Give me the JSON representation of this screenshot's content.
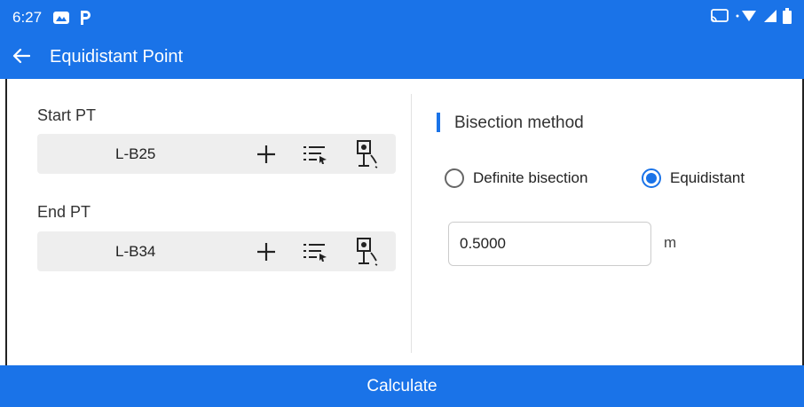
{
  "status_bar": {
    "time": "6:27",
    "icons": [
      "photos-icon",
      "p-icon"
    ],
    "right_icons": [
      "cast-icon",
      "wifi-icon",
      "signal-icon",
      "battery-icon"
    ]
  },
  "app_bar": {
    "title": "Equidistant Point",
    "back_icon": "arrow-left-icon"
  },
  "left_panel": {
    "start_label": "Start PT",
    "start_value": "L-B25",
    "end_label": "End PT",
    "end_value": "L-B34",
    "actions": [
      "plus-icon",
      "list-select-icon",
      "survey-point-icon"
    ]
  },
  "right_panel": {
    "section_title": "Bisection method",
    "options": [
      {
        "label": "Definite bisection",
        "checked": false
      },
      {
        "label": "Equidistant",
        "checked": true
      }
    ],
    "distance_value": "0.5000",
    "unit": "m"
  },
  "footer": {
    "calculate_label": "Calculate"
  },
  "colors": {
    "primary": "#1a73e8",
    "field_bg": "#eeeeee"
  }
}
